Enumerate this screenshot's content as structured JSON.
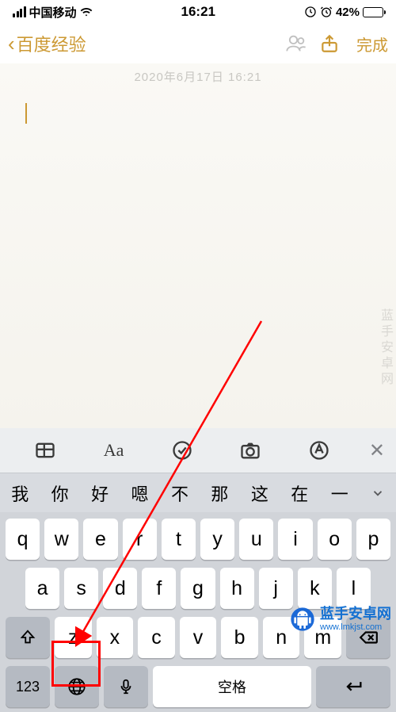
{
  "status": {
    "carrier": "中国移动",
    "time": "16:21",
    "battery_pct": "42%"
  },
  "nav": {
    "back_label": "百度经验",
    "done_label": "完成"
  },
  "note": {
    "timestamp": "2020年6月17日 16:21"
  },
  "format_bar": {
    "aa": "Aa"
  },
  "candidates": [
    "我",
    "你",
    "好",
    "嗯",
    "不",
    "那",
    "这",
    "在",
    "一"
  ],
  "keyboard": {
    "row1": [
      "q",
      "w",
      "e",
      "r",
      "t",
      "y",
      "u",
      "i",
      "o",
      "p"
    ],
    "row2": [
      "a",
      "s",
      "d",
      "f",
      "g",
      "h",
      "j",
      "k",
      "l"
    ],
    "row3": [
      "z",
      "x",
      "c",
      "v",
      "b",
      "n",
      "m"
    ],
    "num_label": "123",
    "space_label": "空格",
    "return_glyph": "↵"
  },
  "watermark": {
    "title": "蓝手安卓网",
    "url": "www.lmkjst.com",
    "vertical": "蓝手安卓网"
  }
}
